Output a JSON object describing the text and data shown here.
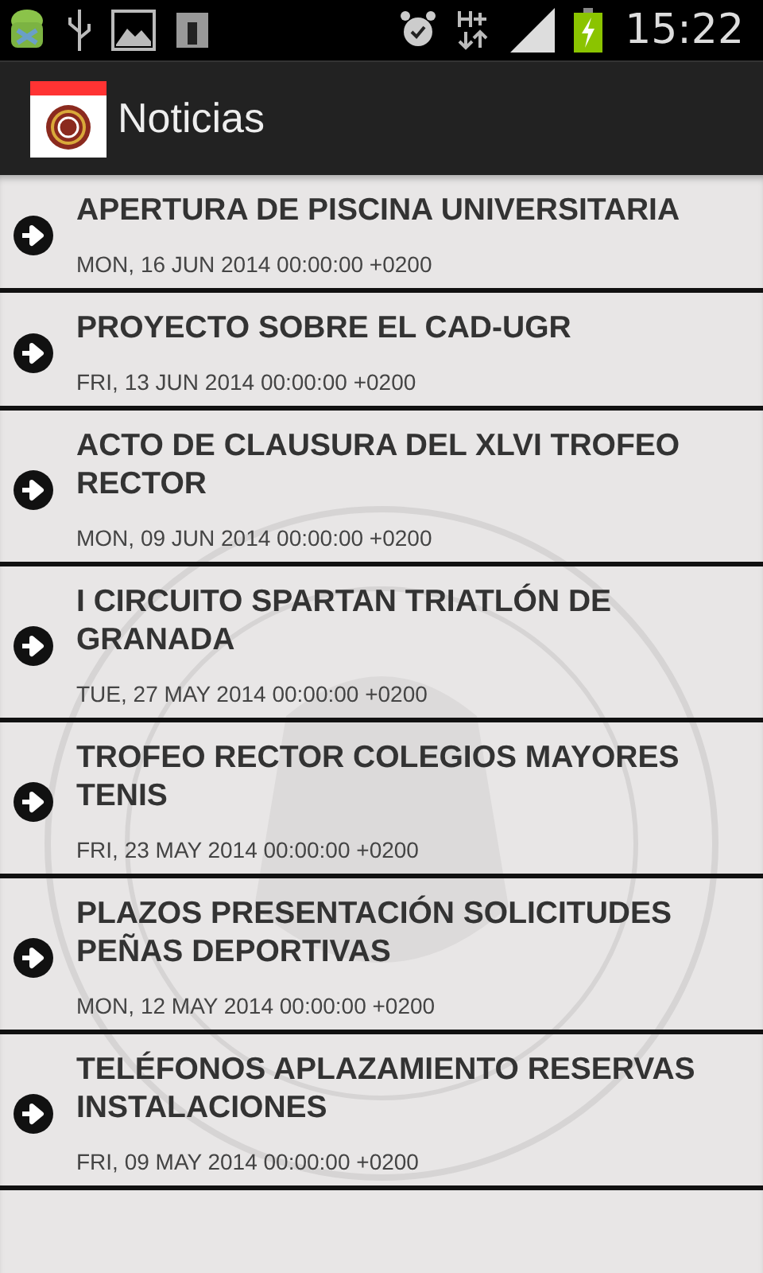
{
  "status_bar": {
    "time": "15:22"
  },
  "app_bar": {
    "title": "Noticias"
  },
  "news": [
    {
      "title": "APERTURA DE PISCINA UNIVERSITARIA",
      "date": "MON, 16 JUN 2014 00:00:00 +0200"
    },
    {
      "title": "PROYECTO SOBRE EL CAD-UGR",
      "date": "FRI, 13 JUN 2014 00:00:00 +0200"
    },
    {
      "title": "ACTO DE CLAUSURA DEL XLVI TROFEO RECTOR",
      "date": "MON, 09 JUN 2014 00:00:00 +0200"
    },
    {
      "title": "I CIRCUITO SPARTAN TRIATLÓN DE GRANADA",
      "date": "TUE, 27 MAY 2014 00:00:00 +0200"
    },
    {
      "title": "TROFEO RECTOR COLEGIOS MAYORES TENIS",
      "date": "FRI, 23 MAY 2014 00:00:00 +0200"
    },
    {
      "title": "PLAZOS PRESENTACIÓN SOLICITUDES PEÑAS DEPORTIVAS",
      "date": "MON, 12 MAY 2014 00:00:00 +0200"
    },
    {
      "title": "TELÉFONOS APLAZAMIENTO RESERVAS INSTALACIONES",
      "date": "FRI, 09 MAY 2014 00:00:00 +0200"
    }
  ]
}
